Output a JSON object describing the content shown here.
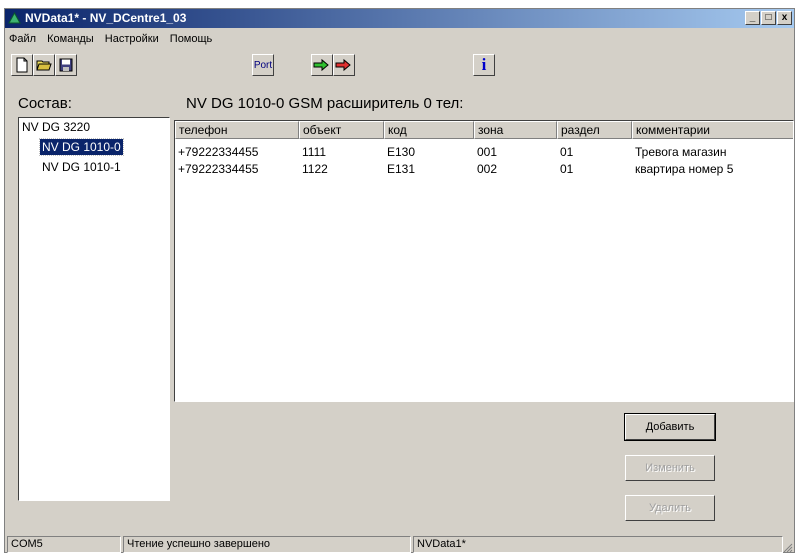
{
  "window": {
    "title": "NVData1* - NV_DCentre1_03",
    "controls": {
      "minimize": "_",
      "maximize": "□",
      "close": "x"
    }
  },
  "menu": [
    "Файл",
    "Команды",
    "Настройки",
    "Помощь"
  ],
  "toolbar": {
    "port_label": "Port",
    "info_label": "i"
  },
  "icons": [
    "new-file-icon",
    "open-folder-icon",
    "save-disk-icon",
    "read-arrow-icon",
    "write-arrow-icon",
    "info-icon"
  ],
  "colors": {
    "selection": "#0a246a",
    "title_start": "#0a246a",
    "title_end": "#a6caf0",
    "face": "#d4d0c8"
  },
  "composition": {
    "label": "Состав:",
    "tree": [
      "NV DG 3220",
      "NV DG 1010-0",
      "NV DG 1010-1"
    ],
    "selected_index": 1
  },
  "table": {
    "title": "NV DG 1010-0 GSM расширитель 0 тел:",
    "columns": [
      "телефон",
      "объект",
      "код",
      "зона",
      "раздел",
      "комментарии"
    ],
    "rows": [
      [
        "+79222334455",
        "1111",
        "E130",
        "001",
        "01",
        "Тревога магазин"
      ],
      [
        "+79222334455",
        "1122",
        "E131",
        "002",
        "01",
        "квартира номер 5"
      ]
    ]
  },
  "buttons": {
    "add": "Добавить",
    "edit": "Изменить",
    "delete": "Удалить"
  },
  "status": {
    "port": "COM5",
    "message": "Чтение успешно завершено",
    "file": "NVData1*"
  }
}
